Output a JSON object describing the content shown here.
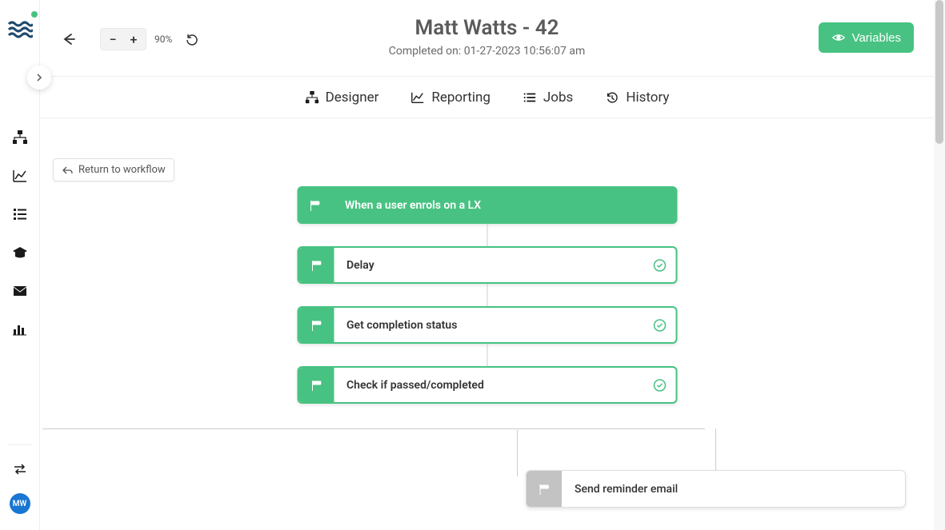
{
  "logo": {
    "initials": "MW"
  },
  "sidebar": {
    "nav": [
      {
        "name": "sitemap-icon"
      },
      {
        "name": "chart-line-icon"
      },
      {
        "name": "list-icon"
      },
      {
        "name": "graduation-cap-icon"
      },
      {
        "name": "envelope-icon"
      },
      {
        "name": "bar-chart-icon"
      }
    ],
    "bottom_icon": "swap-icon",
    "avatar_initials": "MW"
  },
  "topbar": {
    "zoom_level": "90%",
    "title": "Matt Watts - 42",
    "subtitle": "Completed on: 01-27-2023 10:56:07 am",
    "variables_label": "Variables"
  },
  "tabs": [
    {
      "label": "Designer",
      "icon": "sitemap-icon"
    },
    {
      "label": "Reporting",
      "icon": "chart-line-icon"
    },
    {
      "label": "Jobs",
      "icon": "list-icon"
    },
    {
      "label": "History",
      "icon": "history-icon"
    }
  ],
  "canvas": {
    "return_label": "Return to workflow",
    "nodes": [
      {
        "type": "trigger",
        "label": "When a user enrols on a LX"
      },
      {
        "type": "step",
        "label": "Delay",
        "status": "success"
      },
      {
        "type": "step",
        "label": "Get completion status",
        "status": "success"
      },
      {
        "type": "step",
        "label": "Check if passed/completed",
        "status": "success"
      }
    ],
    "branch_node": {
      "type": "inactive",
      "label": "Send reminder email"
    }
  }
}
